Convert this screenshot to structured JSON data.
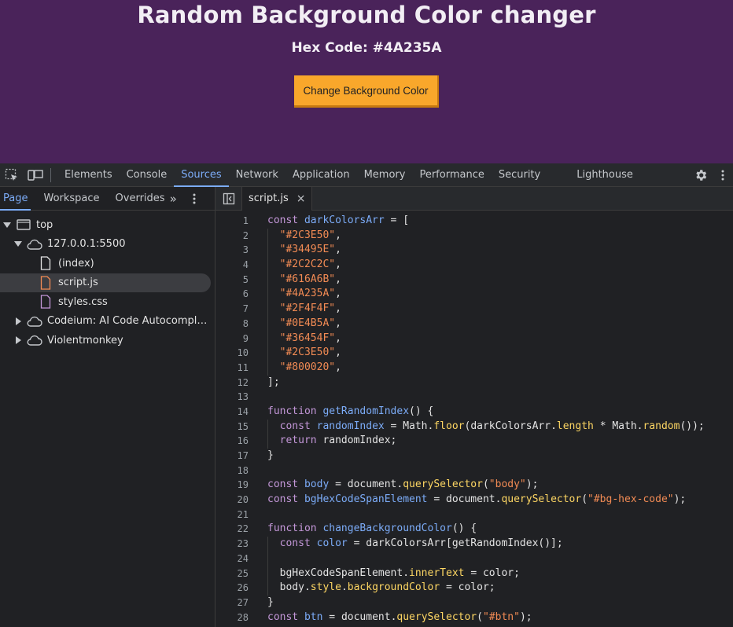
{
  "page": {
    "title": "Random Background Color changer",
    "hex_label": "Hex Code: #4A235A",
    "button_label": "Change Background Color",
    "bg_color": "#4a235a",
    "button_color": "#f9a72b"
  },
  "devtools": {
    "tabs": [
      "Elements",
      "Console",
      "Sources",
      "Network",
      "Application",
      "Memory",
      "Performance",
      "Security",
      "Lighthouse"
    ],
    "active_tab": "Sources",
    "nav_tabs": [
      "Page",
      "Workspace",
      "Overrides"
    ],
    "active_nav_tab": "Page",
    "tree": {
      "top": "top",
      "host": "127.0.0.1:5500",
      "files": [
        "(index)",
        "script.js",
        "styles.css"
      ],
      "ext1": "Codeium: AI Code Autocompleti…",
      "ext2": "Violentmonkey"
    },
    "editor_tab": "script.js",
    "close_glyph": "×",
    "more_glyph": "»"
  },
  "code": [
    "const darkColorsArr = [",
    "  \"#2C3E50\",",
    "  \"#34495E\",",
    "  \"#2C2C2C\",",
    "  \"#616A6B\",",
    "  \"#4A235A\",",
    "  \"#2F4F4F\",",
    "  \"#0E4B5A\",",
    "  \"#36454F\",",
    "  \"#2C3E50\",",
    "  \"#800020\",",
    "];",
    "",
    "function getRandomIndex() {",
    "  const randomIndex = Math.floor(darkColorsArr.length * Math.random());",
    "  return randomIndex;",
    "}",
    "",
    "const body = document.querySelector(\"body\");",
    "const bgHexCodeSpanElement = document.querySelector(\"#bg-hex-code\");",
    "",
    "function changeBackgroundColor() {",
    "  const color = darkColorsArr[getRandomIndex()];",
    "",
    "  bgHexCodeSpanElement.innerText = color;",
    "  body.style.backgroundColor = color;",
    "}",
    "const btn = document.querySelector(\"#btn\");"
  ]
}
